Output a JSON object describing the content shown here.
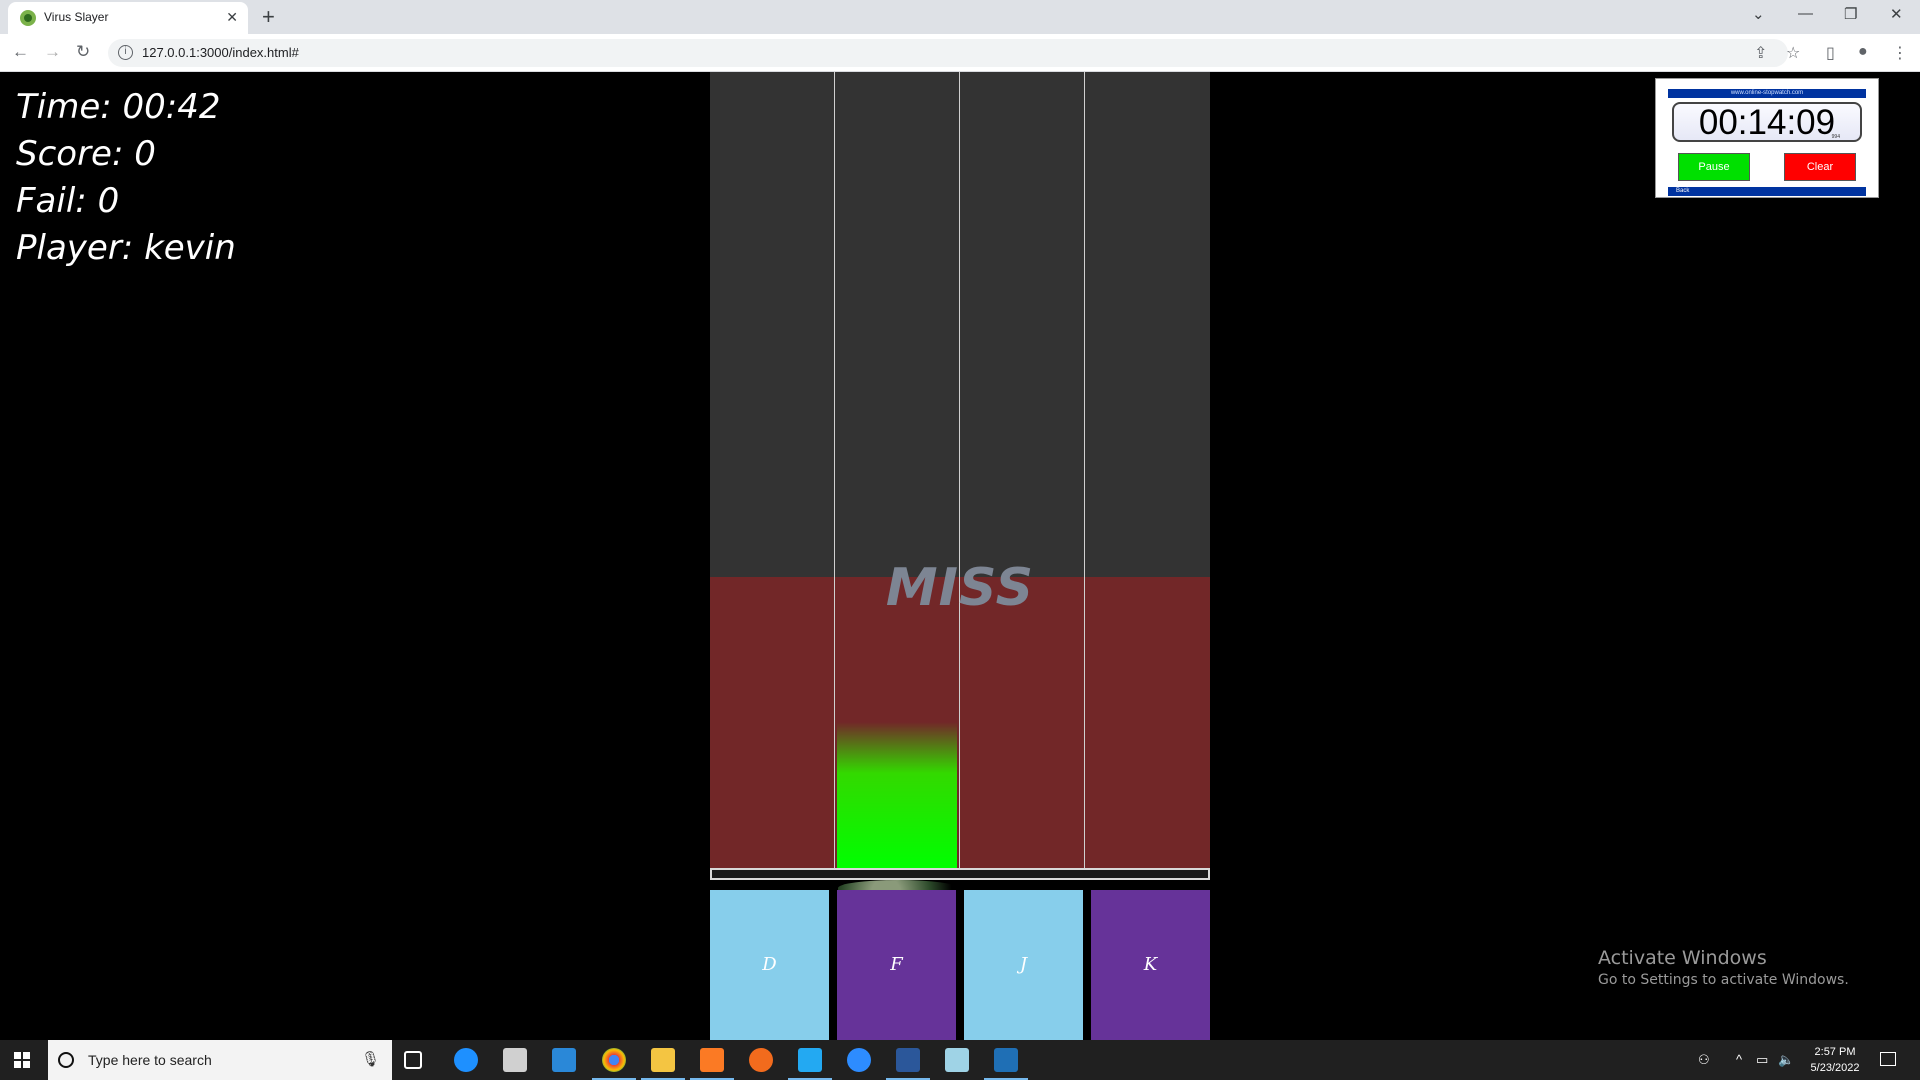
{
  "browser": {
    "tab_title": "Virus Slayer",
    "url": "127.0.0.1:3000/index.html#",
    "new_tab": "+",
    "close": "✕"
  },
  "game": {
    "time_label": "Time:",
    "time_value": "00:42",
    "score_label": "Score:",
    "score_value": "0",
    "fail_label": "Fail:",
    "fail_value": "0",
    "player_label": "Player:",
    "player_value": "kevin",
    "judgement": "MISS",
    "keys": [
      "D",
      "F",
      "J",
      "K"
    ],
    "colors": {
      "lane_top": "#333333",
      "lane_hit": "#722728",
      "key_light": "#87ceeb",
      "key_purple": "#663399",
      "note": "#00ff00"
    }
  },
  "stopwatch": {
    "site": "www.online-stopwatch.com",
    "time": "00:14:09",
    "ms": "994",
    "pause_label": "Pause",
    "clear_label": "Clear",
    "back_label": "Back"
  },
  "watermark": {
    "title": "Activate Windows",
    "subtitle": "Go to Settings to activate Windows."
  },
  "taskbar": {
    "search_placeholder": "Type here to search",
    "time": "2:57 PM",
    "date": "5/23/2022"
  }
}
